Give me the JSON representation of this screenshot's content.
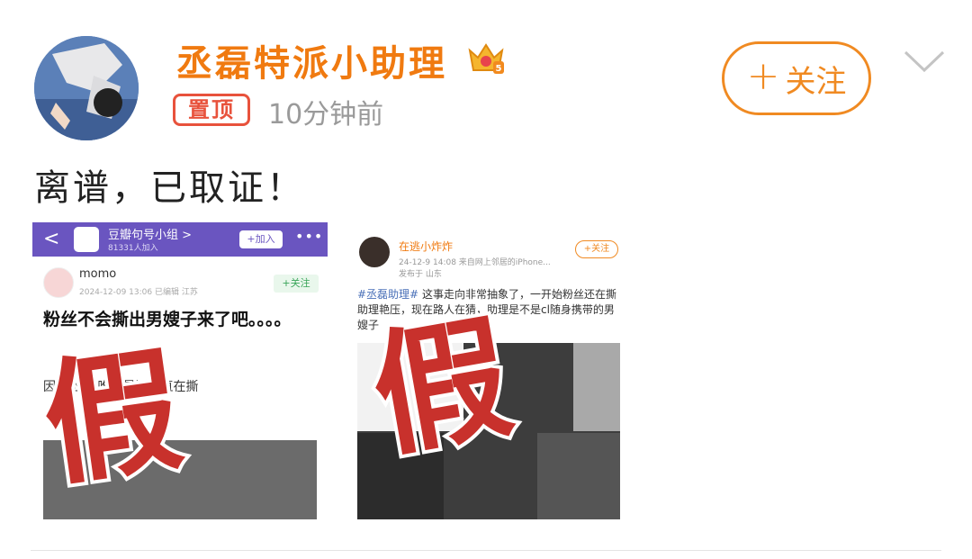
{
  "post": {
    "username": "丞磊特派小助理",
    "pin_badge": "置顶",
    "timestamp": "10分钟前",
    "follow_plus": "+",
    "follow_label": "关注",
    "text": "离谱，已取证！"
  },
  "colors": {
    "username": "#f07a10",
    "follow": "#f08a22",
    "pin": "#e8523c",
    "stamp": "#c8312c",
    "group_bar": "#6a55c0"
  },
  "thumbnail_1": {
    "back": "<",
    "group_name": "豆瓣句号小组 >",
    "members": "81331人加入",
    "join": "+加入",
    "more": "•••",
    "author": "momo",
    "date": "2024-12-09 13:06 已编辑 江苏",
    "follow": "+关注",
    "title": "粉丝不会撕出男嫂子来了吧。。。。",
    "body": "因为丞磊                                       唯粉最近一直在撕",
    "stamp": "假"
  },
  "thumbnail_2": {
    "author": "在逃小炸炸",
    "meta": "24-12-9 14:08 来自网上邻居的iPhone...",
    "location": "发布于 山东",
    "follow": "+关注",
    "hashtag": "#丞磊助理#",
    "text": " 这事走向非常抽象了，一开始粉丝还在撕助理艳压，现在路人在猜，助理是不是cl随身携带的男嫂子",
    "stamp": "假"
  },
  "icons": {
    "avatar": "avatar",
    "crown": "crown-badge-icon",
    "chevron": "chevron-down-icon"
  }
}
